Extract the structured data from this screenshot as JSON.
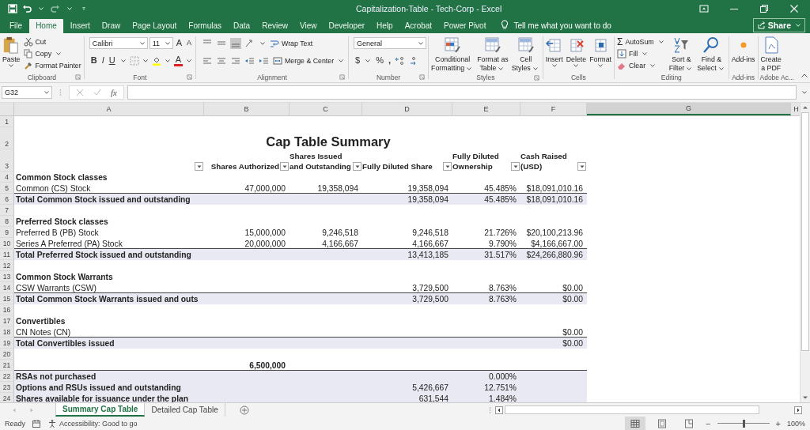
{
  "window": {
    "title": "Capitalization-Table - Tech-Corp - Excel"
  },
  "menu_tabs": [
    {
      "label": "File",
      "selected": false
    },
    {
      "label": "Home",
      "selected": true
    },
    {
      "label": "Insert",
      "selected": false
    },
    {
      "label": "Draw",
      "selected": false
    },
    {
      "label": "Page Layout",
      "selected": false
    },
    {
      "label": "Formulas",
      "selected": false
    },
    {
      "label": "Data",
      "selected": false
    },
    {
      "label": "Review",
      "selected": false
    },
    {
      "label": "View",
      "selected": false
    },
    {
      "label": "Developer",
      "selected": false
    },
    {
      "label": "Help",
      "selected": false
    },
    {
      "label": "Acrobat",
      "selected": false
    },
    {
      "label": "Power Pivot",
      "selected": false
    }
  ],
  "tell_me": "Tell me what you want to do",
  "share": "Share",
  "ribbon": {
    "clipboard": {
      "label": "Clipboard",
      "paste": "Paste",
      "cut": "Cut",
      "copy": "Copy",
      "format_painter": "Format Painter"
    },
    "font": {
      "label": "Font",
      "font_name": "Calibri",
      "font_size": "11",
      "grow": "A",
      "shrink": "A",
      "bold": "B",
      "italic": "I",
      "underline": "U",
      "font_color": "A"
    },
    "alignment": {
      "label": "Alignment",
      "wrap_text": "Wrap Text",
      "merge_center": "Merge & Center"
    },
    "number": {
      "label": "Number",
      "format": "General",
      "currency": "$",
      "percent": "%",
      "comma": ","
    },
    "styles": {
      "label": "Styles",
      "buttons": [
        [
          "Conditional",
          "Formatting"
        ],
        [
          "Format as",
          "Table"
        ],
        [
          "Cell",
          "Styles"
        ]
      ]
    },
    "cells": {
      "label": "Cells",
      "buttons": [
        "Insert",
        "Delete",
        "Format"
      ]
    },
    "editing": {
      "label": "Editing",
      "sigma": "Σ",
      "autosum": "AutoSum",
      "fill": "Fill",
      "clear": "Clear",
      "sort": [
        "Sort &",
        "Filter"
      ],
      "find": [
        "Find &",
        "Select"
      ]
    },
    "addins": {
      "label": "Add-ins",
      "button": "Add-ins"
    },
    "adobe": {
      "label": "Adobe Ac...",
      "button": [
        "Create",
        "a PDF"
      ]
    }
  },
  "formula_bar": {
    "name_box": "G32",
    "fx": "fx"
  },
  "columns": [
    {
      "label": "A",
      "selected": false
    },
    {
      "label": "B",
      "selected": false
    },
    {
      "label": "C",
      "selected": false
    },
    {
      "label": "D",
      "selected": false
    },
    {
      "label": "E",
      "selected": false
    },
    {
      "label": "F",
      "selected": false
    },
    {
      "label": "G",
      "selected": true
    },
    {
      "label": "H",
      "selected": false
    }
  ],
  "rows": [
    {
      "number": "1",
      "kind": "blank",
      "cells": {}
    },
    {
      "number": "2",
      "kind": "title",
      "cells": {
        "B": "Cap Table Summary"
      }
    },
    {
      "number": "3",
      "kind": "header",
      "cells": {
        "B": [
          "Shares Authorized"
        ],
        "C": [
          "Shares Issued",
          "and Outstanding"
        ],
        "D": [
          "Fully Diluted Share"
        ],
        "E": [
          "Fully Diluted",
          "Ownership"
        ],
        "F": [
          "Cash Raised",
          "(USD)"
        ]
      }
    },
    {
      "number": "4",
      "kind": "section",
      "cells": {
        "A": "Common Stock classes"
      }
    },
    {
      "number": "5",
      "kind": "item",
      "cells": {
        "A": "Common (CS) Stock",
        "B": "47,000,000",
        "C": "19,358,094",
        "D": "19,358,094",
        "E": "45.485%",
        "F": "$18,091,010.16"
      }
    },
    {
      "number": "6",
      "kind": "total",
      "cells": {
        "A": "Total Common Stock issued and outstanding",
        "D": "19,358,094",
        "E": "45.485%",
        "F": "$18,091,010.16"
      }
    },
    {
      "number": "7",
      "kind": "blank",
      "cells": {}
    },
    {
      "number": "8",
      "kind": "section",
      "cells": {
        "A": "Preferred Stock classes"
      }
    },
    {
      "number": "9",
      "kind": "item",
      "cells": {
        "A": "Preferred B (PB) Stock",
        "B": "15,000,000",
        "C": "9,246,518",
        "D": "9,246,518",
        "E": "21.726%",
        "F": "$20,100,213.96"
      }
    },
    {
      "number": "10",
      "kind": "item",
      "cells": {
        "A": "Series A Preferred (PA) Stock",
        "B": "20,000,000",
        "C": "4,166,667",
        "D": "4,166,667",
        "E": "9.790%",
        "F": "$4,166,667.00"
      }
    },
    {
      "number": "11",
      "kind": "total",
      "cells": {
        "A": "Total Preferred Stock issued and outstanding",
        "D": "13,413,185",
        "E": "31.517%",
        "F": "$24,266,880.96"
      }
    },
    {
      "number": "12",
      "kind": "blank",
      "cells": {}
    },
    {
      "number": "13",
      "kind": "section",
      "cells": {
        "A": "Common Stock Warrants"
      }
    },
    {
      "number": "14",
      "kind": "item",
      "cells": {
        "A": "CSW Warrants (CSW)",
        "D": "3,729,500",
        "E": "8.763%",
        "F": "$0.00"
      }
    },
    {
      "number": "15",
      "kind": "total",
      "cells": {
        "A": "Total Common Stock Warrants issued and outs",
        "D": "3,729,500",
        "E": "8.763%",
        "F": "$0.00"
      }
    },
    {
      "number": "16",
      "kind": "blank",
      "cells": {}
    },
    {
      "number": "17",
      "kind": "section",
      "cells": {
        "A": "Convertibles"
      }
    },
    {
      "number": "18",
      "kind": "item",
      "cells": {
        "A": "CN Notes (CN)",
        "F": "$0.00"
      }
    },
    {
      "number": "19",
      "kind": "total",
      "cells": {
        "A": "Total Convertibles issued",
        "F": "$0.00"
      }
    },
    {
      "number": "20",
      "kind": "blank",
      "cells": {}
    },
    {
      "number": "21",
      "kind": "figure",
      "cells": {
        "B": "6,500,000"
      }
    },
    {
      "number": "22",
      "kind": "total",
      "cells": {
        "A": "RSAs not purchased",
        "E": "0.000%"
      }
    },
    {
      "number": "23",
      "kind": "plan",
      "cells": {
        "A": "Options and RSUs issued and outstanding",
        "D": "5,426,667",
        "E": "12.751%"
      }
    },
    {
      "number": "24",
      "kind": "plan",
      "cells": {
        "A": "Shares available for issuance under the plan",
        "D": "631,544",
        "E": "1.484%"
      }
    }
  ],
  "sheet_tabs": [
    {
      "label": "Summary Cap Table",
      "selected": true
    },
    {
      "label": "Detailed Cap Table",
      "selected": false
    }
  ],
  "status_bar": {
    "mode": "Ready",
    "accessibility": "Accessibility: Good to go",
    "zoom_minus": "−",
    "zoom_plus": "+",
    "zoom": {
      "level": 0.5,
      "reading": "100%"
    }
  }
}
